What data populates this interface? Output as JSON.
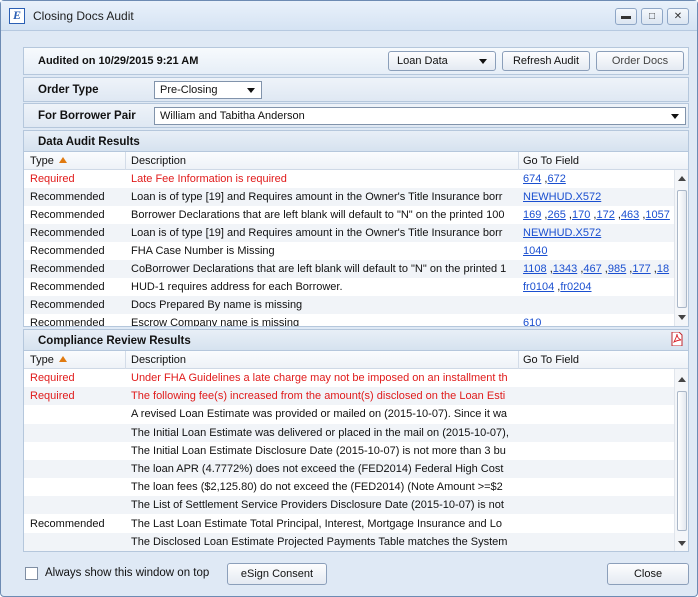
{
  "window": {
    "title": "Closing Docs Audit",
    "app_icon_letter": "E"
  },
  "toolbar": {
    "audited_text": "Audited on 10/29/2015 9:21 AM",
    "loan_data_label": "Loan Data",
    "refresh_label": "Refresh Audit",
    "order_docs_label": "Order Docs"
  },
  "order_type": {
    "label": "Order Type",
    "value": "Pre-Closing"
  },
  "borrower": {
    "label": "For Borrower Pair",
    "value": "William and Tabitha Anderson"
  },
  "data_audit": {
    "title": "Data Audit Results",
    "columns": {
      "type": "Type",
      "description": "Description",
      "goto": "Go To Field"
    },
    "rows": [
      {
        "type": "Required",
        "description": "Late Fee Information is required",
        "links": [
          "674",
          "672"
        ]
      },
      {
        "type": "Recommended",
        "description": "Loan is of type [19] and Requires amount in the Owner's Title Insurance borr",
        "links": [
          "NEWHUD.X572"
        ]
      },
      {
        "type": "Recommended",
        "description": "Borrower Declarations that are left blank will default to \"N\" on the printed 100",
        "links": [
          "169",
          "265",
          "170",
          "172",
          "463",
          "1057"
        ]
      },
      {
        "type": "Recommended",
        "description": "Loan is of type [19] and Requires amount in the Owner's Title Insurance borr",
        "links": [
          "NEWHUD.X572"
        ]
      },
      {
        "type": "Recommended",
        "description": "FHA Case Number is Missing",
        "links": [
          "1040"
        ]
      },
      {
        "type": "Recommended",
        "description": "CoBorrower Declarations that are left blank will default to \"N\" on the printed 1",
        "links": [
          "1108",
          "1343",
          "467",
          "985",
          "177",
          "18"
        ]
      },
      {
        "type": "Recommended",
        "description": "HUD-1 requires address for each Borrower.",
        "links": [
          "fr0104",
          "fr0204"
        ]
      },
      {
        "type": "Recommended",
        "description": "Docs Prepared By name is missing",
        "links": []
      },
      {
        "type": "Recommended",
        "description": "Escrow Company name is missing",
        "links": [
          "610"
        ]
      }
    ]
  },
  "compliance": {
    "title": "Compliance Review Results",
    "columns": {
      "type": "Type",
      "description": "Description",
      "goto": "Go To Field"
    },
    "rows": [
      {
        "type": "Required",
        "description": "Under FHA Guidelines a late charge may not be imposed on an installment th"
      },
      {
        "type": "Required",
        "description": "The following fee(s) increased from the amount(s) disclosed on the Loan Esti"
      },
      {
        "type": "",
        "description": "A revised Loan Estimate was provided or mailed on (2015-10-07). Since it wa"
      },
      {
        "type": "",
        "description": "The Initial Loan Estimate was delivered or placed in the mail on (2015-10-07),"
      },
      {
        "type": "",
        "description": "The Initial Loan Estimate Disclosure Date (2015-10-07) is not more than 3 bu"
      },
      {
        "type": "",
        "description": "The loan APR (4.7772%) does not exceed the (FED2014) Federal High Cost"
      },
      {
        "type": "",
        "description": "The loan fees ($2,125.80) do not exceed the (FED2014) (Note Amount >=$2"
      },
      {
        "type": "",
        "description": "The List of Settlement Service Providers Disclosure Date (2015-10-07) is not"
      },
      {
        "type": "Recommended",
        "description": "The Last Loan Estimate Total Principal, Interest, Mortgage Insurance and Lo"
      },
      {
        "type": "",
        "description": "The Disclosed Loan Estimate Projected Payments Table matches the System"
      }
    ]
  },
  "footer": {
    "always_on_top_label": "Always show this window on top",
    "esign_label": "eSign Consent",
    "close_label": "Close"
  },
  "colors": {
    "required": "#e01b1b",
    "link": "#1a4fd0",
    "sort_arrow": "#e07a10"
  }
}
